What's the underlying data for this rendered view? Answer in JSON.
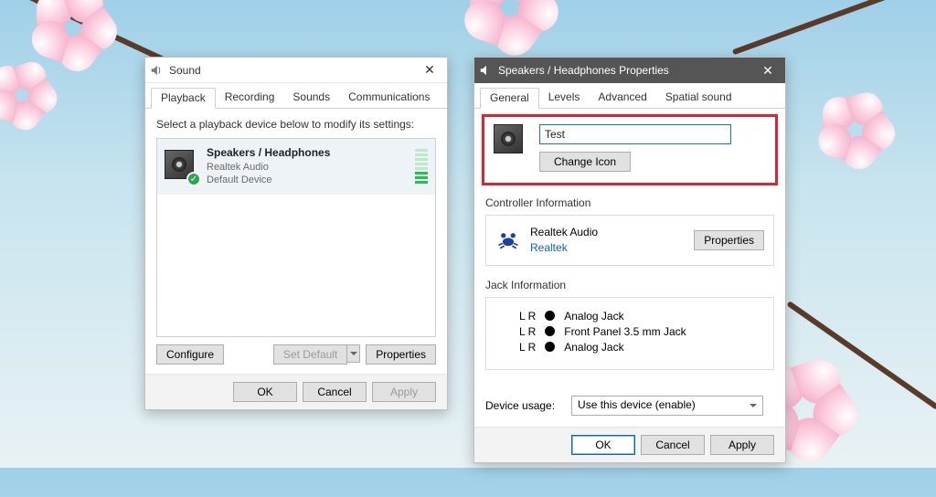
{
  "sound_window": {
    "title": "Sound",
    "close": "✕",
    "tabs": {
      "playback": "Playback",
      "recording": "Recording",
      "sounds": "Sounds",
      "communications": "Communications"
    },
    "hint": "Select a playback device below to modify its settings:",
    "device": {
      "name": "Speakers / Headphones",
      "driver": "Realtek Audio",
      "status": "Default Device",
      "check": "✓"
    },
    "buttons": {
      "configure": "Configure",
      "set_default": "Set Default",
      "properties": "Properties",
      "ok": "OK",
      "cancel": "Cancel",
      "apply": "Apply"
    }
  },
  "props_window": {
    "title": "Speakers / Headphones Properties",
    "close": "✕",
    "tabs": {
      "general": "General",
      "levels": "Levels",
      "advanced": "Advanced",
      "spatial": "Spatial sound"
    },
    "name_value": "Test",
    "change_icon": "Change Icon",
    "controller": {
      "label": "Controller Information",
      "name": "Realtek Audio",
      "vendor": "Realtek",
      "properties": "Properties"
    },
    "jack": {
      "label": "Jack Information",
      "lr": "L R",
      "items": [
        "Analog Jack",
        "Front Panel 3.5 mm Jack",
        "Analog Jack"
      ]
    },
    "usage": {
      "label": "Device usage:",
      "value": "Use this device (enable)"
    },
    "buttons": {
      "ok": "OK",
      "cancel": "Cancel",
      "apply": "Apply"
    }
  }
}
